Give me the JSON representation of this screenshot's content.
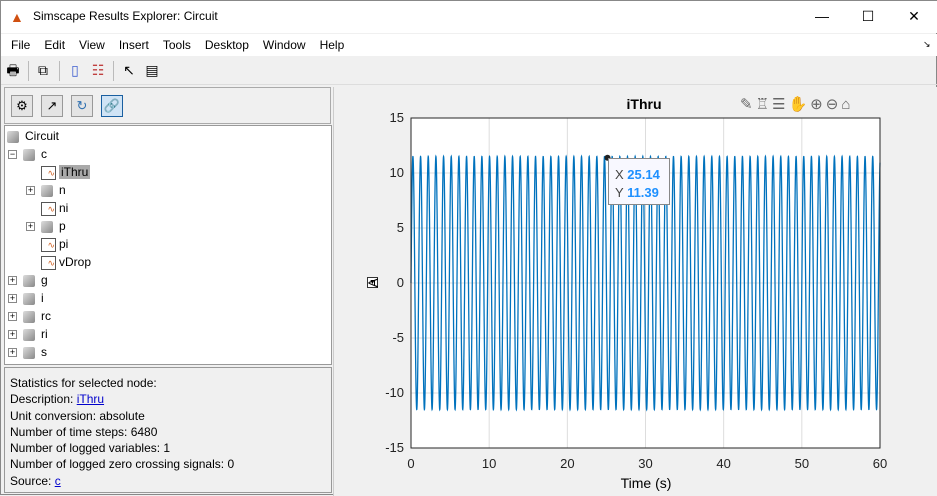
{
  "window": {
    "title": "Simscape Results Explorer: Circuit"
  },
  "menu": [
    "File",
    "Edit",
    "View",
    "Insert",
    "Tools",
    "Desktop",
    "Window",
    "Help"
  ],
  "tree": {
    "root": "Circuit",
    "items": [
      {
        "label": "c",
        "level": 1,
        "expanded": true
      },
      {
        "label": "iThru",
        "level": 2,
        "signal": true,
        "selected": true
      },
      {
        "label": "n",
        "level": 2
      },
      {
        "label": "ni",
        "level": 2,
        "signal": true
      },
      {
        "label": "p",
        "level": 2
      },
      {
        "label": "pi",
        "level": 2,
        "signal": true
      },
      {
        "label": "vDrop",
        "level": 2,
        "signal": true
      },
      {
        "label": "g",
        "level": 1
      },
      {
        "label": "i",
        "level": 1
      },
      {
        "label": "rc",
        "level": 1
      },
      {
        "label": "ri",
        "level": 1
      },
      {
        "label": "s",
        "level": 1
      }
    ]
  },
  "stats": {
    "heading": "Statistics for selected node:",
    "desc_label": "Description: ",
    "desc_link": "iThru",
    "unit": "Unit conversion: absolute",
    "steps": "Number of time steps: 6480",
    "vars": "Number of logged variables: 1",
    "zc": "Number of logged zero crossing signals: 0",
    "source_label": "Source: ",
    "source_link": "c"
  },
  "chart_data": {
    "type": "line",
    "title": "iThru",
    "xlabel": "Time (s)",
    "ylabel": "A",
    "xlim": [
      0,
      60
    ],
    "ylim": [
      -15,
      15
    ],
    "xticks": [
      "0",
      "10",
      "20",
      "30",
      "40",
      "50",
      "60"
    ],
    "yticks": [
      "15",
      "10",
      "5",
      "0",
      "-5",
      "-10",
      "-15"
    ],
    "grid": true,
    "series": [
      {
        "name": "iThru",
        "amplitude": 11.5,
        "frequency_hz": 1,
        "color": "#0072bd"
      }
    ],
    "datatip": {
      "x_label": "X",
      "x": "25.14",
      "y_label": "Y",
      "y": "11.39"
    }
  }
}
